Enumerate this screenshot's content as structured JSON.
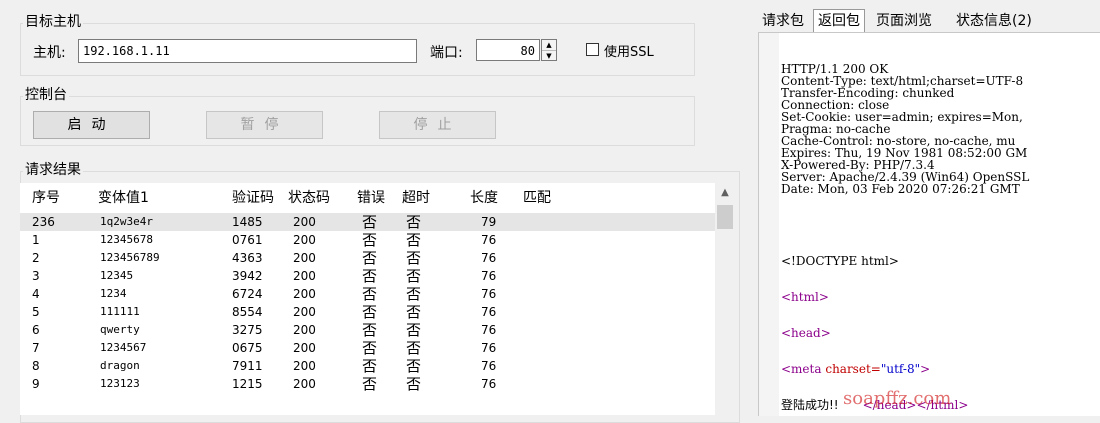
{
  "target": {
    "title": "目标主机",
    "host_label": "主机:",
    "host_value": "192.168.1.11",
    "port_label": "端口:",
    "port_value": "80",
    "ssl_label": "使用SSL"
  },
  "console": {
    "title": "控制台",
    "start": "启动",
    "pause": "暂停",
    "stop": "停止"
  },
  "results": {
    "title": "请求结果",
    "columns": [
      "序号",
      "变体值1",
      "验证码",
      "状态码",
      "错误",
      "超时",
      "长度",
      "匹配"
    ],
    "rows": [
      [
        "236",
        "1q2w3e4r",
        "1485",
        "200",
        "否",
        "否",
        "79",
        ""
      ],
      [
        "1",
        "12345678",
        "0761",
        "200",
        "否",
        "否",
        "76",
        ""
      ],
      [
        "2",
        "123456789",
        "4363",
        "200",
        "否",
        "否",
        "76",
        ""
      ],
      [
        "3",
        "12345",
        "3942",
        "200",
        "否",
        "否",
        "76",
        ""
      ],
      [
        "4",
        "1234",
        "6724",
        "200",
        "否",
        "否",
        "76",
        ""
      ],
      [
        "5",
        "111111",
        "8554",
        "200",
        "否",
        "否",
        "76",
        ""
      ],
      [
        "6",
        "qwerty",
        "3275",
        "200",
        "否",
        "否",
        "76",
        ""
      ],
      [
        "7",
        "1234567",
        "0675",
        "200",
        "否",
        "否",
        "76",
        ""
      ],
      [
        "8",
        "dragon",
        "7911",
        "200",
        "否",
        "否",
        "76",
        ""
      ],
      [
        "9",
        "123123",
        "1215",
        "200",
        "否",
        "否",
        "76",
        ""
      ]
    ]
  },
  "tabs": [
    "请求包",
    "返回包",
    "页面浏览",
    "状态信息(2)"
  ],
  "response": {
    "headers": [
      "HTTP/1.1 200 OK",
      "Content-Type: text/html;charset=UTF-8",
      "Transfer-Encoding: chunked",
      "Connection: close",
      "Set-Cookie: user=admin; expires=Mon,",
      "Pragma: no-cache",
      "Cache-Control: no-store, no-cache, mu",
      "Expires: Thu, 19 Nov 1981 08:52:00 GM",
      "X-Powered-By: PHP/7.3.4",
      "Server: Apache/2.4.39 (Win64) OpenSSL",
      "Date: Mon, 03 Feb 2020 07:26:21 GMT"
    ],
    "doctype": "<!DOCTYPE html>",
    "html_open": "<html>",
    "head_open": "<head>",
    "meta_tag": "<meta",
    "meta_attr": "charset=",
    "meta_val": "\"utf-8\"",
    "meta_close": ">",
    "success_text": "登陆成功!!",
    "head_close": "</head>",
    "html_close": "</html>",
    "watermark": "soapffz.com"
  }
}
